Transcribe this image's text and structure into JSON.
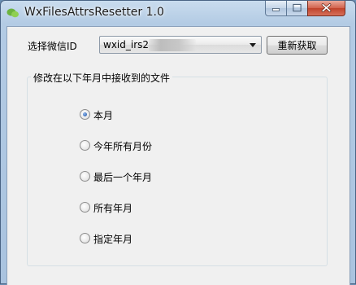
{
  "window": {
    "title": "WxFilesAttrsResetter 1.0"
  },
  "id_row": {
    "label": "选择微信ID",
    "combo_value": "wxid_irs2",
    "refresh_label": "重新获取"
  },
  "group": {
    "legend": "修改在以下年月中接收到的文件",
    "options": [
      {
        "label": "本月",
        "checked": true
      },
      {
        "label": "今年所有月份",
        "checked": false
      },
      {
        "label": "最后一个年月",
        "checked": false
      },
      {
        "label": "所有年月",
        "checked": false
      },
      {
        "label": "指定年月",
        "checked": false
      }
    ]
  },
  "icons": {
    "app": "wechat-bubble-icon",
    "minimize": "minimize-icon",
    "maximize": "maximize-icon",
    "close": "close-icon",
    "dropdown": "chevron-down-icon"
  },
  "colors": {
    "titlebar": "#b3cbe4",
    "close_button": "#c0422a",
    "radio_selected": "#1c4f9e"
  }
}
